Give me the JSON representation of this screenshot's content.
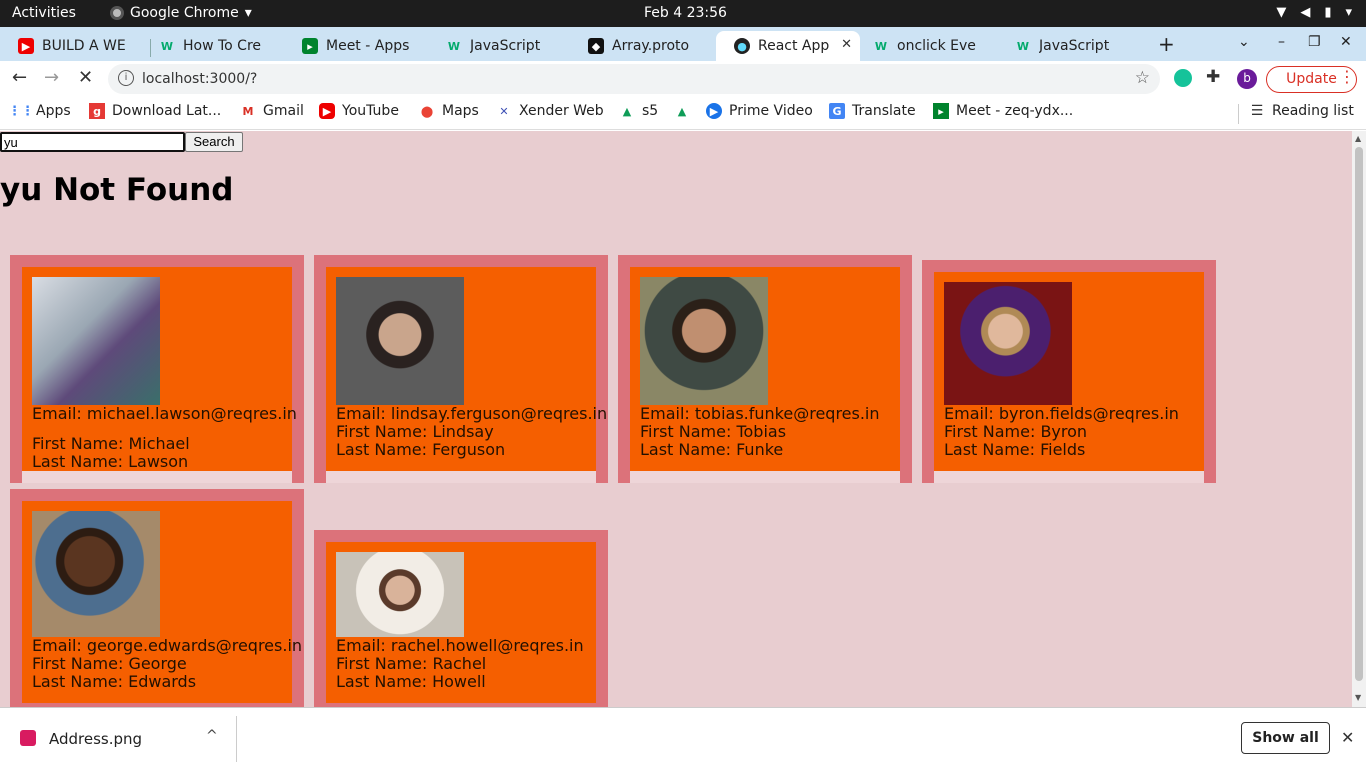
{
  "system_bar": {
    "activities": "Activities",
    "app_name": "Google Chrome",
    "clock": "Feb 4  23:56"
  },
  "tabs": [
    {
      "title": "BUILD A WE",
      "icon": "youtube-icon"
    },
    {
      "title": "How To Cre",
      "icon": "w3schools-icon"
    },
    {
      "title": "Meet - Apps",
      "icon": "meet-icon"
    },
    {
      "title": "JavaScript",
      "icon": "w3schools-icon"
    },
    {
      "title": "Array.proto",
      "icon": "mdn-icon"
    },
    {
      "title": "React App",
      "icon": "react-icon"
    },
    {
      "title": "onclick Eve",
      "icon": "w3schools-icon"
    },
    {
      "title": "JavaScript",
      "icon": "w3schools-icon"
    }
  ],
  "active_tab_index": 5,
  "toolbar": {
    "url": "localhost:3000/?",
    "profile_letter": "b",
    "update_label": "Update"
  },
  "bookmarks": [
    {
      "label": "Apps",
      "icon": "apps-grid-icon"
    },
    {
      "label": "Download Lat...",
      "icon": "bookmark-g-icon"
    },
    {
      "label": "Gmail",
      "icon": "gmail-icon"
    },
    {
      "label": "YouTube",
      "icon": "youtube-icon"
    },
    {
      "label": "Maps",
      "icon": "maps-icon"
    },
    {
      "label": "Xender Web",
      "icon": "xender-icon"
    },
    {
      "label": "s5",
      "icon": "drive-icon"
    },
    {
      "label": "",
      "icon": "drive-icon"
    },
    {
      "label": "Prime Video",
      "icon": "prime-video-icon"
    },
    {
      "label": "Translate",
      "icon": "translate-icon"
    },
    {
      "label": "Meet - zeq-ydx...",
      "icon": "meet-icon"
    }
  ],
  "reading_list": "Reading list",
  "page": {
    "search_value": "yu",
    "search_button": "Search",
    "heading": "yu Not Found",
    "users": [
      {
        "email": "Email: michael.lawson@reqres.in",
        "first": "First Name: Michael",
        "last": "Last Name: Lawson",
        "photo_color": "#6e7a8a"
      },
      {
        "email": "Email: lindsay.ferguson@reqres.in",
        "first": "First Name: Lindsay",
        "last": "Last Name: Ferguson",
        "photo_color": "#5a5a5a"
      },
      {
        "email": "Email: tobias.funke@reqres.in",
        "first": "First Name: Tobias",
        "last": "Last Name: Funke",
        "photo_color": "#6a6a4c"
      },
      {
        "email": "Email: byron.fields@reqres.in",
        "first": "First Name: Byron",
        "last": "Last Name: Fields",
        "photo_color": "#7a1414"
      },
      {
        "email": "Email: george.edwards@reqres.in",
        "first": "First Name: George",
        "last": "Last Name: Edwards",
        "photo_color": "#6b4a2e"
      },
      {
        "email": "Email: rachel.howell@reqres.in",
        "first": "First Name: Rachel",
        "last": "Last Name: Howell",
        "photo_color": "#ded8d0"
      }
    ]
  },
  "download_shelf": {
    "file_name": "Address.png",
    "show_all": "Show all"
  }
}
